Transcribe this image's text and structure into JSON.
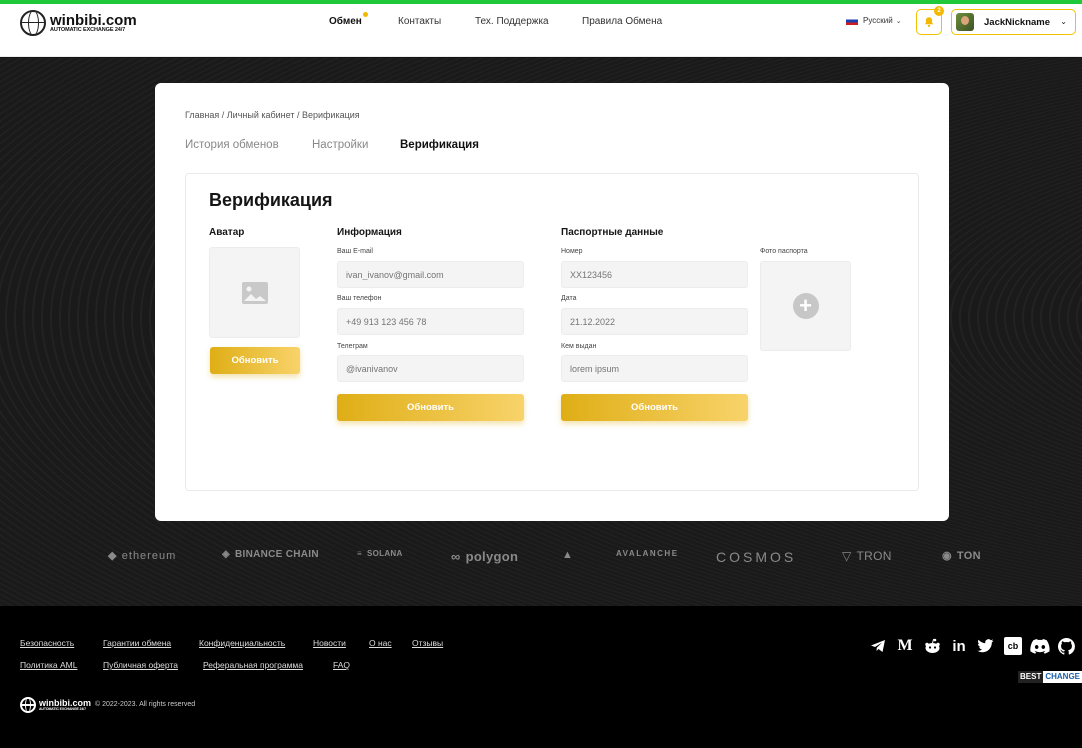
{
  "header": {
    "logo": {
      "name": "winbibi.com",
      "tagline": "AUTOMATIC EXCHANGE 24/7"
    },
    "nav": [
      {
        "label": "Обмен",
        "active": true
      },
      {
        "label": "Контакты"
      },
      {
        "label": "Тех. Поддержка"
      },
      {
        "label": "Правила Обмена"
      }
    ],
    "language": "Русский",
    "notifications_count": "2",
    "username": "JackNickname"
  },
  "breadcrumb": "Главная / Личный кабинет / Верификация",
  "tabs": [
    {
      "label": "История обменов"
    },
    {
      "label": "Настройки"
    },
    {
      "label": "Верификация",
      "active": true
    }
  ],
  "verification": {
    "title": "Верификация",
    "avatar": {
      "heading": "Аватар",
      "button": "Обновить"
    },
    "info": {
      "heading": "Информация",
      "email_label": "Ваш E-mail",
      "email_placeholder": "ivan_ivanov@gmail.com",
      "phone_label": "Ваш телефон",
      "phone_placeholder": "+49 913 123 456 78",
      "telegram_label": "Телеграм",
      "telegram_placeholder": "@ivanivanov",
      "button": "Обновить"
    },
    "passport": {
      "heading": "Паспортные данные",
      "number_label": "Номер",
      "number_placeholder": "XX123456",
      "date_label": "Дата",
      "date_placeholder": "21.12.2022",
      "issued_label": "Кем выдан",
      "issued_placeholder": "lorem ipsum",
      "photo_label": "Фото паспорта",
      "button": "Обновить"
    }
  },
  "partners": [
    "ethereum",
    "BINANCE CHAIN",
    "SOLANA",
    "polygon",
    "AVALANCHE",
    "COSMOS",
    "TRON",
    "TON"
  ],
  "footer": {
    "links_row1": [
      "Безопасность",
      "Гарантии обмена",
      "Конфиденциальность",
      "Новости",
      "О нас",
      "Отзывы"
    ],
    "links_row2": [
      "Политика AML",
      "Публичная оферта",
      "Реферальная программа",
      "FAQ"
    ],
    "logo": {
      "name": "winbibi.com",
      "tagline": "AUTOMATIC EXCHANGE 24/7"
    },
    "copyright": "© 2022-2023. All rights reserved",
    "social_icons": [
      "telegram-icon",
      "medium-icon",
      "reddit-icon",
      "linkedin-icon",
      "twitter-icon",
      "coinbase-icon",
      "discord-icon",
      "github-icon"
    ],
    "bestchange": {
      "part1": "BEST",
      "part2": "CHANGE"
    }
  },
  "colors": {
    "accent": "#f2b900",
    "top_line": "#1fc93a",
    "button_start": "#dfae16",
    "button_end": "#f8d36a"
  }
}
